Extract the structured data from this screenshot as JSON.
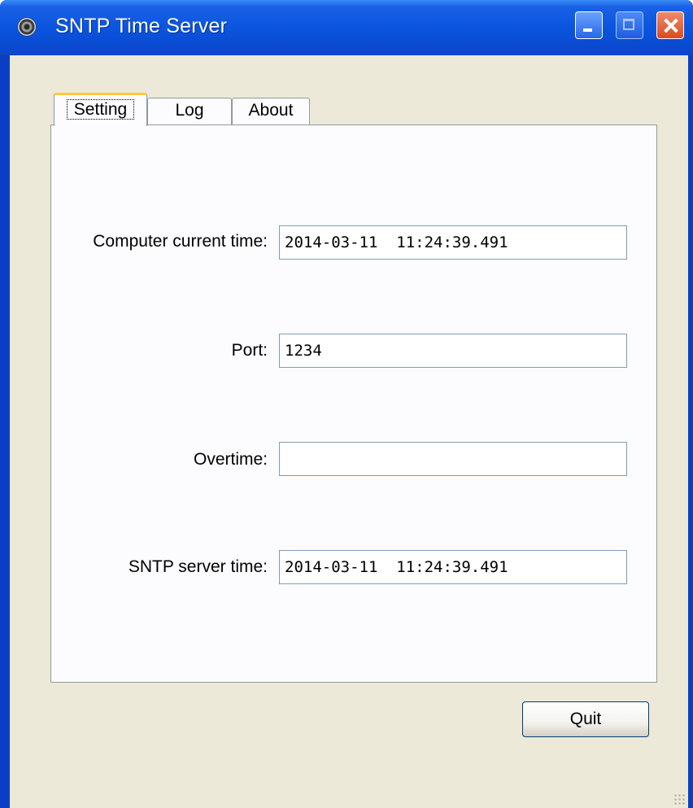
{
  "window": {
    "title": "SNTP Time Server",
    "icon": "app-disc-icon",
    "controls": [
      "minimize-icon",
      "maximize-icon",
      "close-icon"
    ]
  },
  "tabs": [
    {
      "label": "Setting",
      "selected": true
    },
    {
      "label": "Log",
      "selected": false
    },
    {
      "label": "About",
      "selected": false
    }
  ],
  "fields": {
    "computer_time": {
      "label": "Computer current time:",
      "value": "2014-03-11  11:24:39.491"
    },
    "port": {
      "label": "Port:",
      "value": "1234"
    },
    "overtime": {
      "label": "Overtime:",
      "value": ""
    },
    "sntp_time": {
      "label": "SNTP server time:",
      "value": "2014-03-11  11:24:39.491"
    }
  },
  "buttons": {
    "quit_label": "Quit"
  }
}
